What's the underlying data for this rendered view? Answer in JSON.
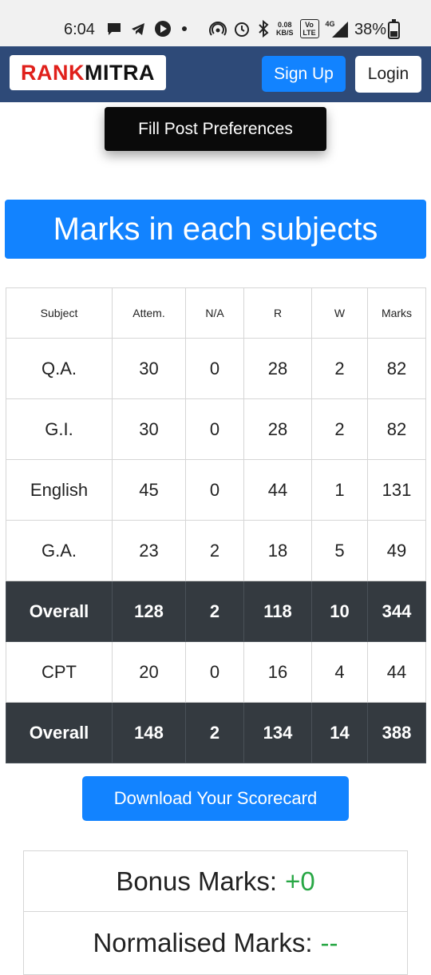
{
  "status_bar": {
    "time": "6:04",
    "data_speed_value": "0.08",
    "data_speed_unit": "KB/S",
    "volte": "Vo LTE",
    "network": "4G",
    "battery": "38%"
  },
  "navbar": {
    "logo_rank": "RANK",
    "logo_mitra": "MITRA",
    "signup_label": "Sign Up",
    "login_label": "Login",
    "brand_color": "#2e4a78",
    "accent_color": "#1283ff"
  },
  "fill_post_label": "Fill Post Preferences",
  "heading": "Marks in each subjects",
  "table": {
    "headers": [
      "Subject",
      "Attem.",
      "N/A",
      "R",
      "W",
      "Marks"
    ],
    "rows": [
      {
        "cells": [
          "Q.A.",
          "30",
          "0",
          "28",
          "2",
          "82"
        ],
        "highlight": false
      },
      {
        "cells": [
          "G.I.",
          "30",
          "0",
          "28",
          "2",
          "82"
        ],
        "highlight": false
      },
      {
        "cells": [
          "English",
          "45",
          "0",
          "44",
          "1",
          "131"
        ],
        "highlight": false
      },
      {
        "cells": [
          "G.A.",
          "23",
          "2",
          "18",
          "5",
          "49"
        ],
        "highlight": false
      },
      {
        "cells": [
          "Overall",
          "128",
          "2",
          "118",
          "10",
          "344"
        ],
        "highlight": true
      },
      {
        "cells": [
          "CPT",
          "20",
          "0",
          "16",
          "4",
          "44"
        ],
        "highlight": false
      },
      {
        "cells": [
          "Overall",
          "148",
          "2",
          "134",
          "14",
          "388"
        ],
        "highlight": true
      }
    ]
  },
  "download_label": "Download Your Scorecard",
  "bonus": {
    "label": "Bonus Marks:",
    "value": "+0"
  },
  "normalised": {
    "label": "Normalised Marks:",
    "value": "--"
  }
}
